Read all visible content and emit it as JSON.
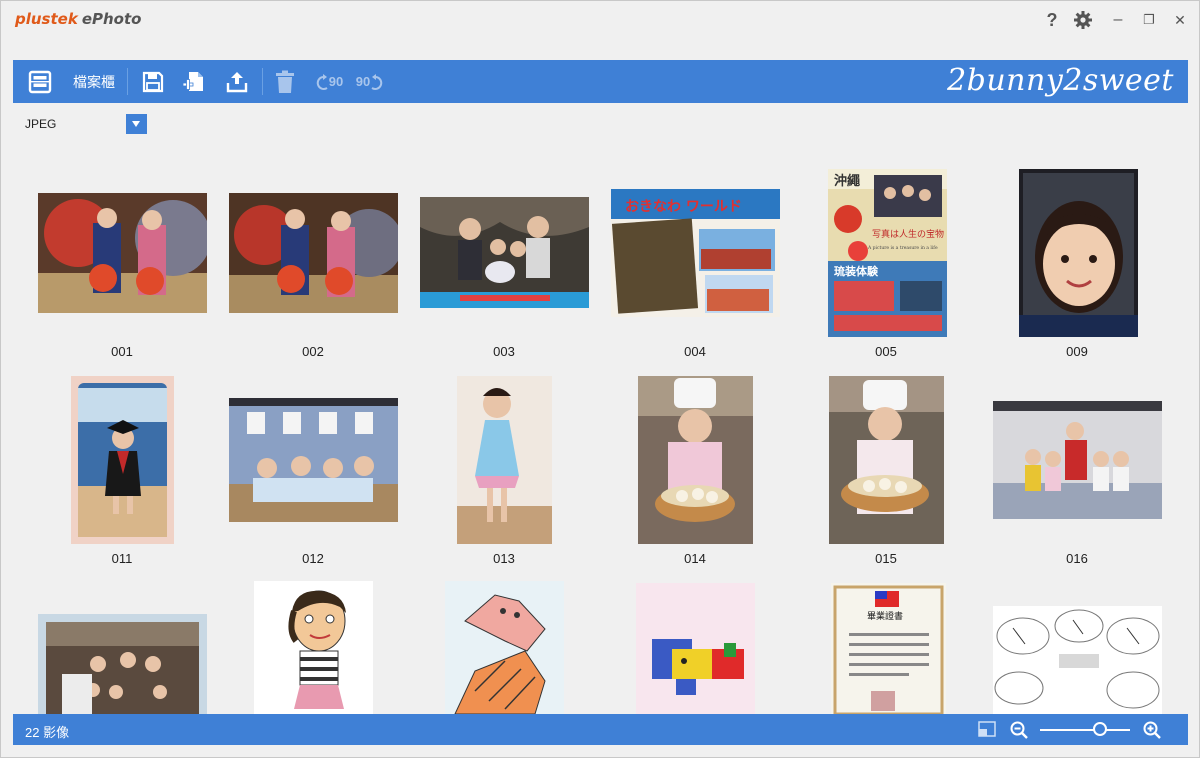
{
  "app": {
    "brand": "plustek",
    "product": "ePhoto"
  },
  "window_controls": {
    "help": "?",
    "minimize": "–",
    "restore": "❐",
    "close": "✕"
  },
  "toolbar": {
    "cabinet_label": "檔案櫃",
    "rotate_left_label": "90",
    "rotate_right_label": "90",
    "watermark": "2bunny2sweet",
    "accent": "#3f80d6"
  },
  "format": {
    "selected": "JPEG"
  },
  "thumbnails": [
    {
      "label": "001"
    },
    {
      "label": "002"
    },
    {
      "label": "003"
    },
    {
      "label": "004"
    },
    {
      "label": "005"
    },
    {
      "label": "009"
    },
    {
      "label": "011"
    },
    {
      "label": "012"
    },
    {
      "label": "013"
    },
    {
      "label": "014"
    },
    {
      "label": "015"
    },
    {
      "label": "016"
    },
    {
      "label": ""
    },
    {
      "label": ""
    },
    {
      "label": ""
    },
    {
      "label": ""
    },
    {
      "label": ""
    },
    {
      "label": ""
    }
  ],
  "photo_texts": {
    "t004_banner": "おきなわ ワールド",
    "t005_title": "沖繩",
    "t005_sub": "写真は人生の宝物",
    "t005_en": "A picture is a treasure in a life",
    "t005_taiken": "琉装体験",
    "t021_title": "畢業證書"
  },
  "status": {
    "count": "22 影像"
  }
}
